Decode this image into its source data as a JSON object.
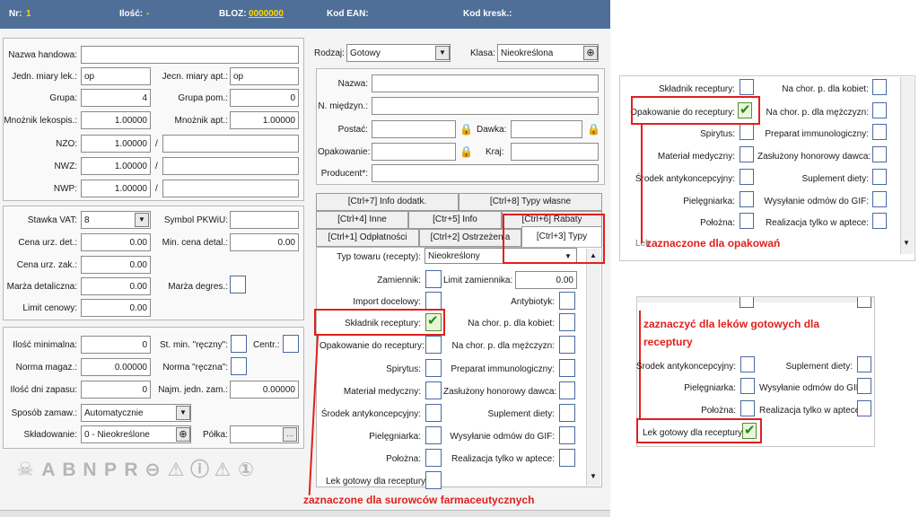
{
  "topbar": {
    "nr_label": "Nr:",
    "nr_value": "1",
    "ilosc_label": "Ilość:",
    "ilosc_value": "-",
    "bloz_label": "BLOZ:",
    "bloz_value": "0000000",
    "ean_label": "Kod EAN:",
    "kresk_label": "Kod kresk.:"
  },
  "colors": {
    "header_bg": "#4f6f98",
    "bloz_value": "#ffd700",
    "annotation": "#e0201c",
    "check": "#1e8a1e"
  },
  "left": {
    "nazwa_label": "Nazwa handowa:",
    "jedn_lek_label": "Jedn. miary lek.:",
    "jedn_lek_value": "op",
    "jedn_apt_label": "Jecn. miary apt.:",
    "jedn_apt_value": "op",
    "grupa_label": "Grupa:",
    "grupa_value": "4",
    "grupa_pom_label": "Grupa pom.:",
    "grupa_pom_value": "0",
    "mnoz_lek_label": "Mnożnik lekospis.:",
    "mnoz_lek_value": "1.00000",
    "mnoz_apt_label": "Mnożnik apt.:",
    "mnoz_apt_value": "1.00000",
    "nzo_label": "NZO:",
    "nzo_value": "1.00000",
    "nwz_label": "NWZ:",
    "nwz_value": "1.00000",
    "nwp_label": "NWP:",
    "nwp_value": "1.00000",
    "slash": "/",
    "vat_label": "Stawka VAT:",
    "vat_value": "8",
    "pkwiu_label": "Symbol PKWiU:",
    "cena_det_label": "Cena urz. det.:",
    "cena_det_value": "0.00",
    "min_cena_label": "Min. cena detal.:",
    "min_cena_value": "0.00",
    "cena_zak_label": "Cena urz. zak.:",
    "cena_zak_value": "0.00",
    "marza_det_label": "Marża detaliczna:",
    "marza_det_value": "0.00",
    "marza_deg_label": "Marża degres.:",
    "limit_label": "Limit cenowy:",
    "limit_value": "0.00",
    "ilosc_min_label": "Ilość minimalna:",
    "ilosc_min_value": "0",
    "st_min_label": "St. min. \"ręczny\":",
    "centr_label": "Centr.:",
    "norma_mag_label": "Norma magaz.:",
    "norma_mag_value": "0.00000",
    "norma_rec_label": "Norma \"ręczna\":",
    "dni_label": "Ilość dni zapasu:",
    "dni_value": "0",
    "najm_label": "Najm. jedn. zam.:",
    "najm_value": "0.00000",
    "sposob_label": "Sposób zamaw.:",
    "sposob_value": "Automatycznie",
    "sklad_label": "Składowanie:",
    "sklad_value": "0 - Nieokreślone",
    "polka_label": "Półka:",
    "status_letters": [
      "A",
      "B",
      "N",
      "P",
      "R"
    ]
  },
  "mid": {
    "rodzaj_label": "Rodzaj:",
    "rodzaj_value": "Gotowy",
    "klasa_label": "Klasa:",
    "klasa_value": "Nieokreślona",
    "nazwa_label": "Nazwa:",
    "miedzyn_label": "N. międzyn.:",
    "postac_label": "Postać:",
    "dawka_label": "Dawka:",
    "opak_label": "Opakowanie:",
    "kraj_label": "Kraj:",
    "producent_label": "Producent*:"
  },
  "tabs": {
    "t7": "[Ctrl+7] Info dodatk.",
    "t8": "[Ctrl+8] Typy własne",
    "t4": "[Ctrl+4] Inne",
    "t5": "[Ctr+5] Info",
    "t6": "[Ctrl+6] Rabaty",
    "t1": "[Ctrl+1] Odpłatności",
    "t2": "[Ctrl+2] Ostrzeżenia",
    "t3": "[Ctrl+3] Typy"
  },
  "types": {
    "typ_label": "Typ towaru (recepty):",
    "typ_value": "Nieokreślony",
    "zamiennik": "Zamiennik:",
    "limit_zam_label": "Limit zamiennika:",
    "limit_zam_value": "0.00",
    "import": "Import docelowy:",
    "antybiotyk": "Antybiotyk:",
    "skladnik": "Składnik receptury:",
    "chor_k": "Na chor. p. dla kobiet:",
    "opak_rec": "Opakowanie do receptury:",
    "chor_m": "Na chor. p. dla mężczyzn:",
    "spirytus": "Spirytus:",
    "immuno": "Preparat immunologiczny:",
    "material": "Materiał medyczny:",
    "zasluzony": "Zasłużony honorowy dawca:",
    "srodek": "Środek antykoncepcyjny:",
    "suplement": "Suplement diety:",
    "pielegniarka": "Pielęgniarka:",
    "gif": "Wysyłanie odmów do GIF:",
    "polozna": "Położna:",
    "apteka": "Realizacja tylko w aptece:",
    "lek_gotowy": "Lek gotowy dla receptury"
  },
  "annotations": {
    "surowce": "zaznaczone dla surowców farmaceutycznych",
    "opakowan": "zaznaczone dla opakowań",
    "gotowe_line1": "zaznaczyć dla leków gotowych dla",
    "gotowe_line2": "receptury"
  },
  "inset1": {
    "skladnik": "Składnik receptury:",
    "chor_k": "Na chor. p. dla kobiet:",
    "opak_rec": "Opakowanie do receptury:",
    "chor_m": "Na chor. p. dla mężczyzn:",
    "spirytus": "Spirytus:",
    "immuno": "Preparat immunologiczny:",
    "material": "Materiał medyczny:",
    "zasluzony": "Zasłużony honorowy dawca:",
    "srodek": "Środek antykoncepcyjny:",
    "suplement": "Suplement diety:",
    "pielegniarka": "Pielęgniarka:",
    "gif": "Wysyłanie odmów do GIF:",
    "polozna": "Położna:",
    "apteka": "Realizacja tylko w aptece:",
    "lek": "Lek"
  },
  "inset2": {
    "srodek": "Środek antykoncepcyjny:",
    "suplement": "Suplement diety:",
    "pielegniarka": "Pielęgniarka:",
    "gif": "Wysyłanie odmów do GIF:",
    "polozna": "Położna:",
    "apteka": "Realizacja tylko w aptece:",
    "lek_gotowy": "Lek gotowy dla receptury"
  }
}
